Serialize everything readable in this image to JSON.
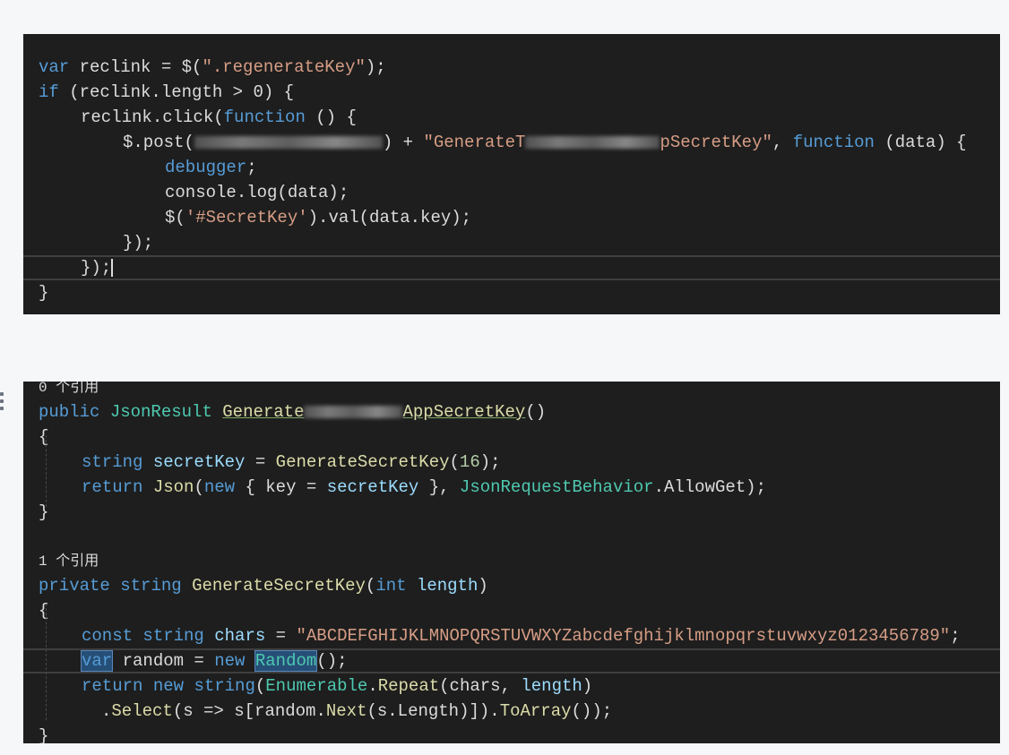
{
  "js_panel": {
    "lines": [
      {
        "indent": 0,
        "tokens": [
          {
            "t": "var",
            "c": "kw"
          },
          {
            "t": " reclink = $(",
            "c": "pl"
          },
          {
            "t": "\".regenerateKey\"",
            "c": "str"
          },
          {
            "t": ");",
            "c": "pl"
          }
        ]
      },
      {
        "indent": 0,
        "tokens": [
          {
            "t": "if",
            "c": "kw"
          },
          {
            "t": " (reclink.length > 0) {",
            "c": "pl"
          }
        ]
      },
      {
        "indent": 1,
        "tokens": [
          {
            "t": "reclink.click(",
            "c": "pl"
          },
          {
            "t": "function",
            "c": "kw"
          },
          {
            "t": " () {",
            "c": "pl"
          }
        ]
      },
      {
        "indent": 2,
        "tokens": [
          {
            "t": "$.post(",
            "c": "pl"
          },
          {
            "blur": 210
          },
          {
            "t": ") + ",
            "c": "pl"
          },
          {
            "t": "\"GenerateT",
            "c": "str"
          },
          {
            "blur": 150
          },
          {
            "t": "pSecretKey\"",
            "c": "str"
          },
          {
            "t": ", ",
            "c": "pl"
          },
          {
            "t": "function",
            "c": "kw"
          },
          {
            "t": " (data) {",
            "c": "pl"
          }
        ]
      },
      {
        "indent": 3,
        "tokens": [
          {
            "t": "debugger",
            "c": "kw"
          },
          {
            "t": ";",
            "c": "pl"
          }
        ]
      },
      {
        "indent": 3,
        "tokens": [
          {
            "t": "console.log(data);",
            "c": "pl"
          }
        ]
      },
      {
        "indent": 3,
        "tokens": [
          {
            "t": "$(",
            "c": "pl"
          },
          {
            "t": "'#SecretKey'",
            "c": "str"
          },
          {
            "t": ").val(data.key);",
            "c": "pl"
          }
        ]
      },
      {
        "indent": 2,
        "tokens": [
          {
            "t": "});",
            "c": "pl"
          }
        ]
      },
      {
        "indent": 1,
        "current": true,
        "tokens": [
          {
            "t": "});",
            "c": "pl"
          },
          {
            "caret": true
          }
        ]
      },
      {
        "indent": 0,
        "tokens": [
          {
            "t": "}",
            "c": "pl"
          }
        ]
      }
    ]
  },
  "cs_panel": {
    "lines": [
      {
        "lens": true,
        "indent": 0,
        "tokens": [
          {
            "t": "0 个引用",
            "c": "pl"
          }
        ]
      },
      {
        "indent": 0,
        "tokens": [
          {
            "t": "public",
            "c": "kw"
          },
          {
            "t": " ",
            "c": "pl"
          },
          {
            "t": "JsonResult",
            "c": "cls"
          },
          {
            "t": " ",
            "c": "pl"
          },
          {
            "t": "Generate",
            "c": "fn",
            "ul": true
          },
          {
            "blur": 110
          },
          {
            "t": "AppSecretKey",
            "c": "fn",
            "ul": true
          },
          {
            "t": "()",
            "c": "pl"
          }
        ]
      },
      {
        "indent": 0,
        "tokens": [
          {
            "t": "{",
            "c": "pl"
          }
        ]
      },
      {
        "indent": 1,
        "tokens": [
          {
            "t": "string",
            "c": "kw"
          },
          {
            "t": " ",
            "c": "pl"
          },
          {
            "t": "secretKey",
            "c": "id"
          },
          {
            "t": " = ",
            "c": "pl"
          },
          {
            "t": "GenerateSecretKey",
            "c": "fn"
          },
          {
            "t": "(",
            "c": "pl"
          },
          {
            "t": "16",
            "c": "num"
          },
          {
            "t": ");",
            "c": "pl"
          }
        ]
      },
      {
        "indent": 1,
        "tokens": [
          {
            "t": "return",
            "c": "kw"
          },
          {
            "t": " ",
            "c": "pl"
          },
          {
            "t": "Json",
            "c": "fn"
          },
          {
            "t": "(",
            "c": "pl"
          },
          {
            "t": "new",
            "c": "kw"
          },
          {
            "t": " { key = ",
            "c": "pl"
          },
          {
            "t": "secretKey",
            "c": "id"
          },
          {
            "t": " }, ",
            "c": "pl"
          },
          {
            "t": "JsonRequestBehavior",
            "c": "cls"
          },
          {
            "t": ".AllowGet);",
            "c": "pl"
          }
        ]
      },
      {
        "indent": 0,
        "tokens": [
          {
            "t": "}",
            "c": "pl"
          }
        ]
      },
      {
        "indent": 0,
        "tokens": [
          {
            "t": "",
            "c": "pl"
          }
        ]
      },
      {
        "lens": true,
        "indent": 0,
        "tokens": [
          {
            "t": "1 个引用",
            "c": "pl"
          }
        ]
      },
      {
        "indent": 0,
        "tokens": [
          {
            "t": "private",
            "c": "kw"
          },
          {
            "t": " ",
            "c": "pl"
          },
          {
            "t": "string",
            "c": "kw"
          },
          {
            "t": " ",
            "c": "pl"
          },
          {
            "t": "GenerateSecretKey",
            "c": "fn"
          },
          {
            "t": "(",
            "c": "pl"
          },
          {
            "t": "int",
            "c": "kw"
          },
          {
            "t": " ",
            "c": "pl"
          },
          {
            "t": "length",
            "c": "id"
          },
          {
            "t": ")",
            "c": "pl"
          }
        ]
      },
      {
        "indent": 0,
        "tokens": [
          {
            "t": "{",
            "c": "pl"
          }
        ]
      },
      {
        "indent": 1,
        "tokens": [
          {
            "t": "const",
            "c": "kw"
          },
          {
            "t": " ",
            "c": "pl"
          },
          {
            "t": "string",
            "c": "kw"
          },
          {
            "t": " ",
            "c": "pl"
          },
          {
            "t": "chars",
            "c": "id"
          },
          {
            "t": " = ",
            "c": "pl"
          },
          {
            "t": "\"ABCDEFGHIJKLMNOPQRSTUVWXYZabcdefghijklmnopqrstuvwxyz0123456789\"",
            "c": "str"
          },
          {
            "t": ";",
            "c": "pl"
          }
        ]
      },
      {
        "indent": 1,
        "current": true,
        "tokens": [
          {
            "t": "var",
            "c": "kw",
            "sel": true
          },
          {
            "t": " random = ",
            "c": "pl"
          },
          {
            "t": "new",
            "c": "kw"
          },
          {
            "t": " ",
            "c": "pl"
          },
          {
            "t": "Random",
            "c": "cls",
            "sel": true
          },
          {
            "t": "();",
            "c": "pl"
          }
        ]
      },
      {
        "indent": 1,
        "tokens": [
          {
            "t": "return",
            "c": "kw"
          },
          {
            "t": " ",
            "c": "pl"
          },
          {
            "t": "new",
            "c": "kw"
          },
          {
            "t": " ",
            "c": "pl"
          },
          {
            "t": "string",
            "c": "kw"
          },
          {
            "t": "(",
            "c": "pl"
          },
          {
            "t": "Enumerable",
            "c": "cls"
          },
          {
            "t": ".",
            "c": "pl"
          },
          {
            "t": "Repeat",
            "c": "fn"
          },
          {
            "t": "(chars, ",
            "c": "pl"
          },
          {
            "t": "length",
            "c": "id"
          },
          {
            "t": ")",
            "c": "pl"
          }
        ]
      },
      {
        "indent": 1,
        "extra": 1,
        "tokens": [
          {
            "t": ".",
            "c": "pl"
          },
          {
            "t": "Select",
            "c": "fn"
          },
          {
            "t": "(s => s[random.",
            "c": "pl"
          },
          {
            "t": "Next",
            "c": "fn"
          },
          {
            "t": "(s.Length)]).",
            "c": "pl"
          },
          {
            "t": "ToArray",
            "c": "fn"
          },
          {
            "t": "());",
            "c": "pl"
          }
        ]
      },
      {
        "indent": 0,
        "tokens": [
          {
            "t": "}",
            "c": "pl"
          }
        ]
      }
    ]
  }
}
